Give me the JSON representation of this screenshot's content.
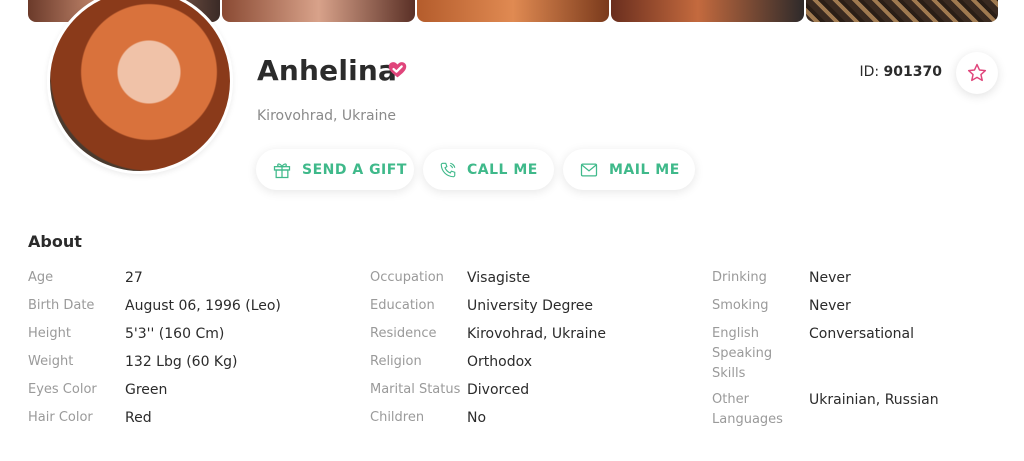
{
  "profile": {
    "name": "Anhelina",
    "location": "Kirovohrad, Ukraine",
    "id_label": "ID:",
    "id_value": "901370"
  },
  "actions": {
    "send_gift": "SEND A GIFT",
    "call_me": "CALL ME",
    "mail_me": "MAIL ME"
  },
  "about": {
    "title": "About",
    "col1": [
      {
        "label": "Age",
        "value": "27"
      },
      {
        "label": "Birth Date",
        "value": "August 06, 1996 (Leo)"
      },
      {
        "label": "Height",
        "value": "5'3'' (160 Cm)"
      },
      {
        "label": "Weight",
        "value": "132 Lbg (60 Kg)"
      },
      {
        "label": "Eyes Color",
        "value": "Green"
      },
      {
        "label": "Hair Color",
        "value": "Red"
      }
    ],
    "col2": [
      {
        "label": "Occupation",
        "value": "Visagiste"
      },
      {
        "label": "Education",
        "value": "University Degree"
      },
      {
        "label": "Residence",
        "value": "Kirovohrad, Ukraine"
      },
      {
        "label": "Religion",
        "value": "Orthodox"
      },
      {
        "label": "Marital Status",
        "value": "Divorced"
      },
      {
        "label": "Children",
        "value": "No"
      }
    ],
    "col3": [
      {
        "label": "Drinking",
        "value": "Never"
      },
      {
        "label": "Smoking",
        "value": "Never"
      },
      {
        "label": "English Speaking Skills",
        "value": "Conversational"
      },
      {
        "label": "Other Languages",
        "value": "Ukrainian, Russian"
      }
    ]
  },
  "colors": {
    "accent": "#3fb98a",
    "verified": "#e0457b"
  },
  "icons": [
    "verified-badge-icon",
    "star-icon",
    "gift-icon",
    "phone-icon",
    "mail-icon"
  ]
}
